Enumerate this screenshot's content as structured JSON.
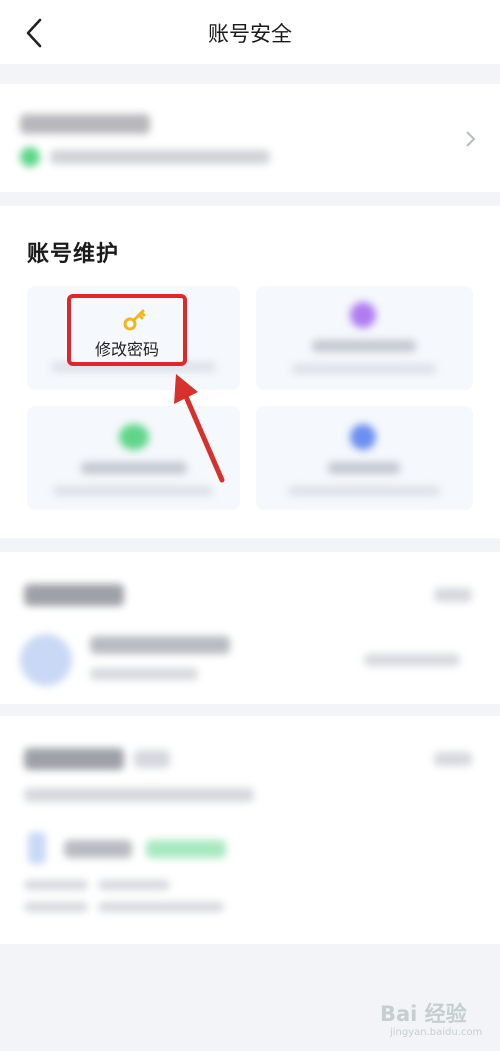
{
  "header": {
    "title": "账号安全"
  },
  "maintenance": {
    "section_title": "账号维护",
    "highlighted_tile_label": "修改密码"
  },
  "watermark": {
    "logo_text": "Bai 经验",
    "site": "jingyan.baidu.com"
  },
  "colors": {
    "highlight_border": "#e0262a",
    "arrow": "#d8302c",
    "key_icon": "#f2b51c"
  },
  "icons": {
    "back": "chevron-left-icon",
    "key": "key-icon"
  }
}
